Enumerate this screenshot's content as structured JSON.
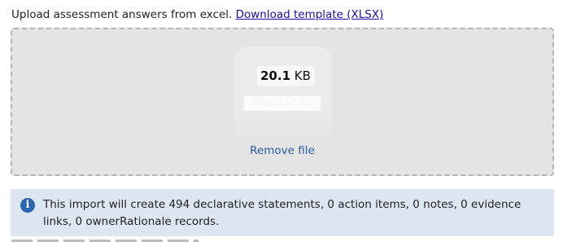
{
  "upload": {
    "intro_text": "Upload assessment answers from excel.",
    "template_link": "Download template (XLSX)"
  },
  "file": {
    "size_value": "20.1",
    "size_unit": "KB",
    "name": "FFIEC CAT S...",
    "remove_label": "Remove file"
  },
  "info": {
    "icon": "info-icon",
    "message": "This import will create 494 declarative statements, 0 action items, 0 notes, 0 evidence links, 0 ownerRationale records."
  },
  "colors": {
    "link": "#1a0dab",
    "remove_link": "#2b5ca8",
    "dropzone_bg": "#e4e4e4",
    "info_bg": "#dde6f3",
    "info_icon": "#2a67b3"
  }
}
